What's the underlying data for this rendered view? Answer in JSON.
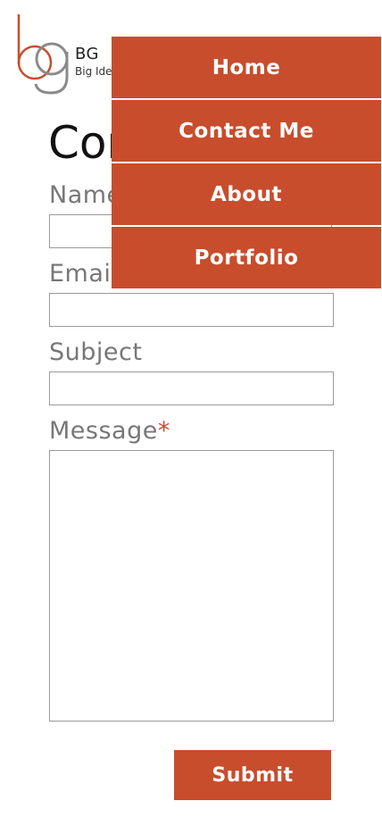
{
  "brand": {
    "initials": "BG",
    "name": "Big Ideas"
  },
  "page": {
    "title": "Contact"
  },
  "form": {
    "fields": [
      {
        "label": "Name",
        "required": false,
        "value": ""
      },
      {
        "label": "Email",
        "required": false,
        "value": ""
      },
      {
        "label": "Subject",
        "required": false,
        "value": ""
      },
      {
        "label": "Message",
        "required": true,
        "required_mark": "*",
        "value": ""
      }
    ],
    "submit_label": "Submit"
  },
  "nav": {
    "items": [
      {
        "label": "Home"
      },
      {
        "label": "Contact Me"
      },
      {
        "label": "About"
      },
      {
        "label": "Portfolio"
      }
    ]
  },
  "colors": {
    "accent": "#c84d2c",
    "label": "#777777",
    "border": "#9a9a9a"
  }
}
